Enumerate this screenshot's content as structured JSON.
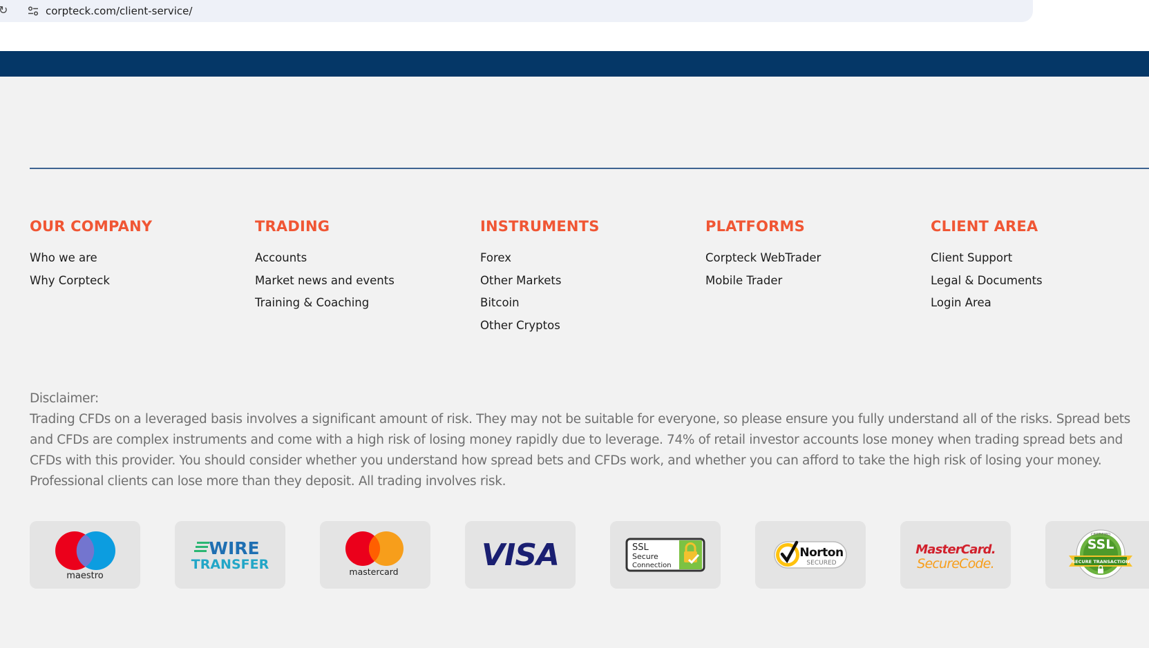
{
  "browser": {
    "url": "corpteck.com/client-service/"
  },
  "footer": {
    "columns": [
      {
        "title": "OUR COMPANY",
        "links": [
          "Who we are",
          "Why Corpteck"
        ]
      },
      {
        "title": "TRADING",
        "links": [
          "Accounts",
          "Market news and events",
          "Training & Coaching"
        ]
      },
      {
        "title": "INSTRUMENTS",
        "links": [
          "Forex",
          "Other Markets",
          "Bitcoin",
          "Other Cryptos"
        ]
      },
      {
        "title": "PLATFORMS",
        "links": [
          "Corpteck WebTrader",
          "Mobile Trader"
        ]
      },
      {
        "title": "CLIENT AREA",
        "links": [
          "Client Support",
          "Legal & Documents",
          "Login Area"
        ]
      }
    ],
    "disclaimer": {
      "title": "Disclaimer:",
      "text": "Trading CFDs on a leveraged basis involves a significant amount of risk. They may not be suitable for everyone, so please ensure you fully understand all of the risks. Spread bets and CFDs are complex instruments and come with a high risk of losing money rapidly due to leverage. 74% of retail investor accounts lose money when trading spread bets and CFDs with this provider. You should consider whether you understand how spread bets and CFDs work, and whether you can afford to take the high risk of losing your money. Professional clients can lose more than they deposit. All trading involves risk."
    },
    "payment_badges": {
      "maestro": "maestro",
      "wire_top": "WIRE",
      "wire_bottom": "TRANSFER",
      "mastercard": "mastercard",
      "visa": "VISA",
      "ssl_line1": "SSL",
      "ssl_line2": "Secure",
      "ssl_line3": "Connection",
      "norton_name": "Norton",
      "norton_sub": "SECURED",
      "mc_secure_1": "MasterCard.",
      "mc_secure_2": "SecureCode.",
      "ssl_cert_main": "SSL",
      "ssl_cert_top": "CERTIFIED",
      "ssl_cert_ribbon": "SECURE TRANSACTION"
    },
    "colors": {
      "navy": "#053767",
      "heading_orange": "#f05634",
      "divider_blue": "#3d6391"
    }
  }
}
